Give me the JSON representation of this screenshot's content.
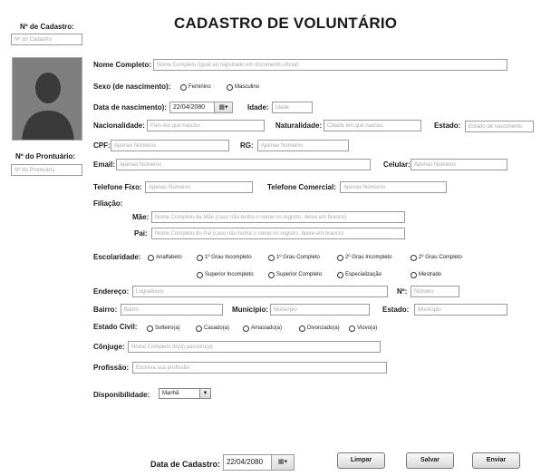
{
  "title": "CADASTRO DE VOLUNTÁRIO",
  "cadastro": {
    "label": "Nº de Cadastro:",
    "placeholder": "Nº do Cadastro"
  },
  "prontuario": {
    "label": "Nº do Prontuário:",
    "placeholder": "Nº do Prontuário"
  },
  "nome": {
    "label": "Nome Completo:",
    "placeholder": "Nome Completo (igual ao registrado em documento oficial)"
  },
  "sexo": {
    "label": "Sexo (de nascimento):",
    "options": [
      "Feminino",
      "Masculino"
    ]
  },
  "nascimento": {
    "label": "Data de nascimento):",
    "value": "22/04/2080"
  },
  "idade": {
    "label": "Idade:",
    "placeholder": "Idade"
  },
  "nacionalidade": {
    "label": "Nacionalidade:",
    "placeholder": "País em que nasceu"
  },
  "naturalidade": {
    "label": "Naturalidade:",
    "placeholder": "Cidade em que nasceu"
  },
  "estado_nasc": {
    "label": "Estado:",
    "placeholder": "Estado de nascimento"
  },
  "cpf": {
    "label": "CPF:",
    "placeholder": "Apenas Números"
  },
  "rg": {
    "label": "RG:",
    "placeholder": "Apenas Números"
  },
  "email": {
    "label": "Email:",
    "placeholder": "Apenas Números"
  },
  "celular": {
    "label": "Celular:",
    "placeholder": "Apenas Números"
  },
  "tel_fixo": {
    "label": "Telefone Fixo:",
    "placeholder": "Apenas Números"
  },
  "tel_comercial": {
    "label": "Telefone Comercial:",
    "placeholder": "Apenas Números"
  },
  "filiacao": {
    "label": "Filiação:",
    "mae_label": "Mãe:",
    "mae_placeholder": "Nome Completo da Mãe (caso não tenha o nome no registro, deixe em branco)",
    "pai_label": "Pai:",
    "pai_placeholder": "Nome Completo do Pai (caso não tenha o nome no registro, deixe em branco)"
  },
  "escolaridade": {
    "label": "Escolaridade:",
    "options": [
      "Analfabeto",
      "1º Grau Incompleto",
      "1º Grau Completo",
      "2º Grau Incompleto",
      "2º Grau Completo",
      "Superior Incompleto",
      "Superior Completo",
      "Especialização",
      "Mestrado"
    ]
  },
  "endereco": {
    "label": "Endereço:",
    "placeholder": "Logradouro"
  },
  "numero": {
    "label": "Nº:",
    "placeholder": "Número"
  },
  "bairro": {
    "label": "Bairro:",
    "placeholder": "Bairro"
  },
  "municipio": {
    "label": "Município:",
    "placeholder": "Município"
  },
  "estado_end": {
    "label": "Estado:",
    "placeholder": "Município"
  },
  "estado_civil": {
    "label": "Estado Civil:",
    "options": [
      "Solteiro(a)",
      "Casado(a)",
      "Amasiado(a)",
      "Divorciado(a)",
      "Viúvo(a)"
    ]
  },
  "conjuge": {
    "label": "Cônjuge:",
    "placeholder": "Nome Completo do(a) parceiro(a)"
  },
  "profissao": {
    "label": "Profissão:",
    "placeholder": "Escreva sua profissão"
  },
  "disponibilidade": {
    "label": "Disponibilidade:",
    "value": "Manhã"
  },
  "data_cadastro": {
    "label": "Data de Cadastro:",
    "value": "22/04/2080"
  },
  "buttons": {
    "limpar": "Limpar",
    "salvar": "Salvar",
    "enviar": "Enviar"
  },
  "icons": {
    "calendar": "calendar-icon",
    "dropdown": "chevron-down-icon",
    "avatar": "person-silhouette-icon"
  }
}
